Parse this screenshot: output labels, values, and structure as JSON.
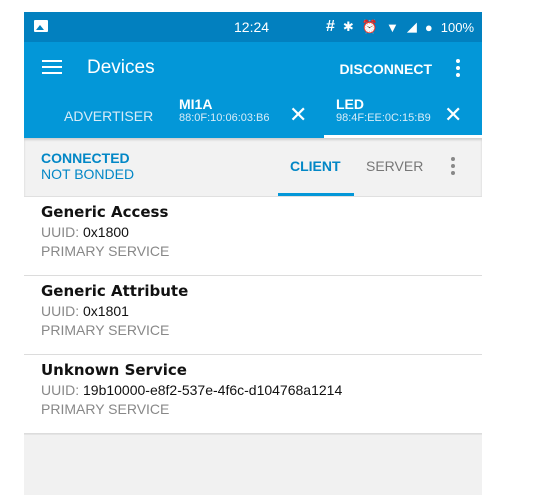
{
  "status_bar": {
    "time": "12:24",
    "icons": [
      "image-icon",
      "hash-icon",
      "bluetooth-icon",
      "alarm-icon",
      "wifi-icon",
      "signal-icon",
      "battery-saver-icon"
    ],
    "battery": "100%"
  },
  "app_bar": {
    "title": "Devices",
    "disconnect_label": "DISCONNECT"
  },
  "device_tabs": [
    {
      "label": "ADVERTISER"
    },
    {
      "name": "MI1A",
      "address": "88:0F:10:06:03:B6"
    },
    {
      "name": "LED",
      "address": "98:4F:EE:0C:15:B9",
      "selected": true
    }
  ],
  "connection": {
    "state": "CONNECTED",
    "bond": "NOT BONDED"
  },
  "mode_tabs": [
    {
      "label": "CLIENT",
      "selected": true
    },
    {
      "label": "SERVER"
    }
  ],
  "services": [
    {
      "name": "Generic Access",
      "uuid_label": "UUID: ",
      "uuid": "0x1800",
      "type": "PRIMARY SERVICE"
    },
    {
      "name": "Generic Attribute",
      "uuid_label": "UUID: ",
      "uuid": "0x1801",
      "type": "PRIMARY SERVICE"
    },
    {
      "name": "Unknown Service",
      "uuid_label": "UUID: ",
      "uuid": "19b10000-e8f2-537e-4f6c-d104768a1214",
      "type": "PRIMARY SERVICE"
    }
  ]
}
